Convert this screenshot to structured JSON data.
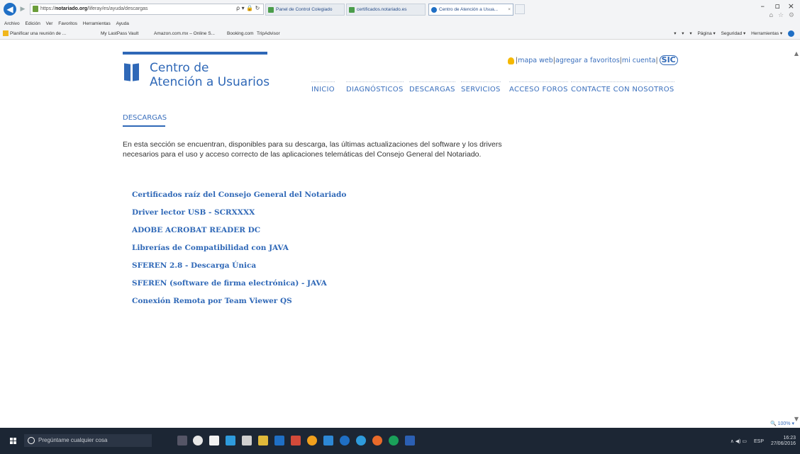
{
  "browser": {
    "address_prefix": "https://",
    "address_domain": "notariado.org",
    "address_rest": "/liferay/es/ayuda/descargas",
    "address_tools": "ρ ▾ 🔒 ↻",
    "tabs": [
      {
        "label": "Panel de Control Colegiado"
      },
      {
        "label": "certificados.notariado.es"
      },
      {
        "label": "Centro de Atención a Usua...",
        "close": "×"
      }
    ],
    "window_controls": [
      "–",
      "▫",
      "×"
    ],
    "right_icons": "⌂ ☆ ⚙",
    "menu": [
      "Archivo",
      "Edición",
      "Ver",
      "Favoritos",
      "Herramientas",
      "Ayuda"
    ],
    "favorites": [
      "Planificar una reunión de ...",
      "My LastPass Vault",
      "Amazon.com.mx – Online S...",
      "Booking.com",
      "TripAdvisor"
    ],
    "command_bar": [
      "▾",
      "▾",
      "▾",
      "Página ▾",
      "Seguridad ▾",
      "Herramientas ▾"
    ]
  },
  "site": {
    "title_line1": "Centro de",
    "title_line2": "Atención a Usuarios",
    "top_links": {
      "sitemap": "mapa web",
      "favorites": "agregar a favoritos",
      "account": "mi cuenta",
      "sep": "|",
      "logo": "SIC"
    },
    "nav": [
      "INICIO",
      "DIAGNÓSTICOS",
      "DESCARGAS",
      "SERVICIOS",
      "ACCESO FOROS",
      "CONTACTE CON NOSOTROS"
    ],
    "section_title": "DESCARGAS",
    "intro": "En esta sección se encuentran, disponibles para su descarga, las últimas actualizaciones del software y los drivers necesarios para el uso y acceso correcto de las aplicaciones telemáticas del Consejo General del Notariado.",
    "downloads": [
      "Certificados raíz del Consejo General del Notariado",
      "Driver lector USB - SCRXXXX",
      "ADOBE ACROBAT READER DC",
      "Librerías de Compatibilidad con JAVA",
      "SFEREN 2.8 - Descarga Única",
      "SFEREN (software de firma electrónica) - JAVA",
      "Conexión Remota por Team Viewer QS"
    ]
  },
  "statusbar": {
    "zoom": "🔍 100% ▾"
  },
  "taskbar": {
    "search_placeholder": "Pregúntame cualquier cosa",
    "time": "16:23",
    "date": "27/06/2016",
    "lang": "ESP",
    "tray": "∧ ◀) ▭"
  },
  "colors": {
    "brand": "#2f68b7",
    "link": "#3a6fbd",
    "taskbar": "#1c2634"
  }
}
